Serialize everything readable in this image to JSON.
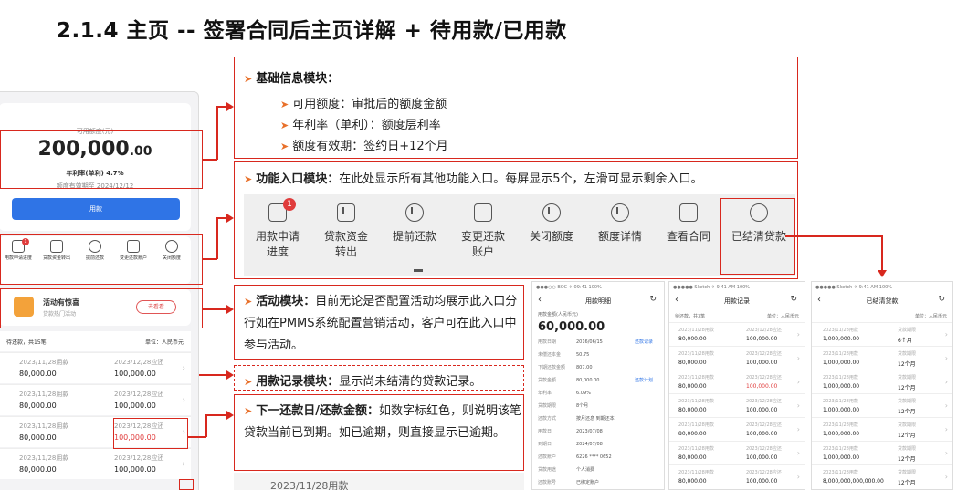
{
  "title": "2.1.4 主页 -- 签署合同后主页详解 + 待用款/已用款",
  "phone": {
    "credit_label": "可用额度(元)",
    "credit_amount_int": "200,000",
    "credit_amount_dec": ".00",
    "rate": "年利率(单利) 4.7%",
    "validity": "额度有效期至 2024/12/12",
    "borrow_button": "用款",
    "functions": [
      {
        "label": "用款申请进度",
        "icon": "apply-progress-icon",
        "badge": "1"
      },
      {
        "label": "贷款资金转出",
        "icon": "transfer-icon"
      },
      {
        "label": "提前还款",
        "icon": "clock-icon"
      },
      {
        "label": "变更还款账户",
        "icon": "card-icon"
      },
      {
        "label": "关闭额度",
        "icon": "power-icon"
      }
    ],
    "activity_title": "活动有惊喜",
    "activity_sub": "贷款热门活动",
    "activity_button": "去看看",
    "records_head_left": "待还款，共15笔",
    "records_head_right": "单位：人民币元",
    "records": [
      {
        "date1": "2023/11/28用款",
        "amt1": "80,000.00",
        "date2": "2023/12/28应还",
        "amt2": "100,000.00",
        "overdue": false
      },
      {
        "date1": "2023/11/28用款",
        "amt1": "80,000.00",
        "date2": "2023/12/28应还",
        "amt2": "100,000.00",
        "overdue": false
      },
      {
        "date1": "2023/11/28用款",
        "amt1": "80,000.00",
        "date2": "2023/12/28应还",
        "amt2": "100,000.00",
        "overdue": true
      },
      {
        "date1": "2023/11/28用款",
        "amt1": "80,000.00",
        "date2": "2023/12/28应还",
        "amt2": "100,000.00",
        "overdue": false
      }
    ]
  },
  "basic": {
    "title": "基础信息模块：",
    "items": [
      "可用额度：审批后的额度金额",
      "年利率（单利）：额度层利率",
      "额度有效期：签约日+12个月"
    ]
  },
  "func_module": {
    "title": "功能入口模块：",
    "desc": "在此处显示所有其他功能入口。每屏显示5个，左滑可显示剩余入口。",
    "items": [
      {
        "label_1": "用款申请",
        "label_2": "进度",
        "icon": "apply-progress-icon",
        "badge": "1"
      },
      {
        "label_1": "贷款资金",
        "label_2": "转出",
        "icon": "transfer-icon"
      },
      {
        "label_1": "提前还款",
        "label_2": "",
        "icon": "clock-icon"
      },
      {
        "label_1": "变更还款",
        "label_2": "账户",
        "icon": "card-icon"
      },
      {
        "label_1": "关闭额度",
        "label_2": "",
        "icon": "power-icon"
      },
      {
        "label_1": "额度详情",
        "label_2": "",
        "icon": "pie-chart-icon"
      },
      {
        "label_1": "查看合同",
        "label_2": "",
        "icon": "contract-icon"
      },
      {
        "label_1": "已结清贷款",
        "label_2": "",
        "icon": "check-circle-icon"
      }
    ]
  },
  "activity_module": {
    "title": "活动模块：",
    "desc": "目前无论是否配置活动均展示此入口分行如在PMMS系统配置营销活动，客户可在此入口中参与活动。"
  },
  "record_module": {
    "title": "用款记录模块：",
    "desc": "显示尚未结清的贷款记录。"
  },
  "nextpay_module": {
    "title": "下一还款日/还款金额：",
    "desc": "如数字标红色，则说明该笔贷款当前已到期。如已逾期，则直接显示已逾期。"
  },
  "partial_row_date": "2023/11/28用款",
  "detail_screen": {
    "status": "●●●○○ BOC ✈    09:41    100%",
    "nav_title": "用款明细",
    "sub": "用款金额(人民币元)",
    "amount": "60,000.00",
    "rows": [
      {
        "k": "用款日期",
        "v": "2016/06/15",
        "link": "还款记录"
      },
      {
        "k": "未偿还本金",
        "v": "50.75"
      },
      {
        "k": "下期还款金额",
        "v": "807.00"
      },
      {
        "k": "贷款金额",
        "v": "80,000.00",
        "link": "还款计划"
      },
      {
        "k": "年利率",
        "v": "6.09%"
      },
      {
        "k": "贷款期限",
        "v": "8个月"
      },
      {
        "k": "还款方式",
        "v": "按月还息 到期还本"
      },
      {
        "k": "用款日",
        "v": "2023/07/08"
      },
      {
        "k": "到期日",
        "v": "2024/07/08"
      },
      {
        "k": "还款账户",
        "v": "6226 **** 0652"
      },
      {
        "k": "贷款用途",
        "v": "个人消费"
      },
      {
        "k": "还款账号",
        "v": "已绑定账户"
      }
    ]
  },
  "record_screen": {
    "status": "●●●●● Sketch ✈    9:41 AM    100%",
    "nav_title": "用款记录",
    "sub_left": "待还款，共3笔",
    "sub_right": "单位：人民币元",
    "rows": [
      {
        "d1": "2023/11/28用款",
        "a1": "80,000.00",
        "d2": "2023/12/28应还",
        "a2": "100,000.00",
        "red": false
      },
      {
        "d1": "2023/11/28用款",
        "a1": "80,000.00",
        "d2": "2023/12/28应还",
        "a2": "100,000.00",
        "red": false
      },
      {
        "d1": "2023/11/28用款",
        "a1": "80,000.00",
        "d2": "2023/12/28应还",
        "a2": "100,000.00",
        "red": true
      },
      {
        "d1": "2023/11/28用款",
        "a1": "80,000.00",
        "d2": "2023/12/28应还",
        "a2": "100,000.00",
        "red": false
      },
      {
        "d1": "2023/11/28用款",
        "a1": "80,000.00",
        "d2": "2023/12/28应还",
        "a2": "100,000.00",
        "red": false
      },
      {
        "d1": "2023/11/28用款",
        "a1": "80,000.00",
        "d2": "2023/12/28应还",
        "a2": "100,000.00",
        "red": false
      },
      {
        "d1": "2023/11/28用款",
        "a1": "80,000.00",
        "d2": "2023/12/28应还",
        "a2": "100,000.00",
        "red": false
      }
    ]
  },
  "settled_screen": {
    "status": "●●●●● Sketch ✈    9:41 AM    100%",
    "nav_title": "已结清贷款",
    "sub_right": "单位：人民币元",
    "rows": [
      {
        "d1": "2023/11/28用款",
        "a1": "1,000,000.00",
        "d2": "贷款期限",
        "a2": "6个月"
      },
      {
        "d1": "2023/11/28用款",
        "a1": "1,000,000.00",
        "d2": "贷款期限",
        "a2": "12个月"
      },
      {
        "d1": "2023/11/28用款",
        "a1": "1,000,000.00",
        "d2": "贷款期限",
        "a2": "12个月"
      },
      {
        "d1": "2023/11/28用款",
        "a1": "1,000,000.00",
        "d2": "贷款期限",
        "a2": "12个月"
      },
      {
        "d1": "2023/11/28用款",
        "a1": "1,000,000.00",
        "d2": "贷款期限",
        "a2": "12个月"
      },
      {
        "d1": "2023/11/28用款",
        "a1": "1,000,000.00",
        "d2": "贷款期限",
        "a2": "12个月"
      },
      {
        "d1": "2023/11/28用款",
        "a1": "8,000,000,000,000.00",
        "d2": "贷款期限",
        "a2": "12个月"
      }
    ]
  },
  "colors": {
    "annotation_red": "#d8281e",
    "accent_blue": "#2f74e6",
    "bullet_orange": "#e8702a",
    "overdue_red": "#e03c3c"
  }
}
